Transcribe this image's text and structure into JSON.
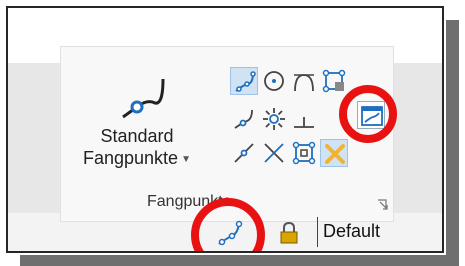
{
  "ribbon": {
    "big_button_line1": "Standard",
    "big_button_line2": "Fangpunkte",
    "group_label": "Fangpunkte"
  },
  "statusbar": {
    "level_name": "Default"
  },
  "icons": {
    "big": "snap-path-icon",
    "grid": [
      "keypoint-snap-icon",
      "center-snap-icon",
      "tangent-snap-icon",
      "origin-snap-icon",
      "nearest-snap-icon",
      "intersection-snap-icon",
      "perpendicular-snap-icon",
      "through-point-snap-icon",
      "midpoint-snap-icon",
      "bisector-snap-icon",
      "multi-snap-icon",
      "snap-off-icon"
    ],
    "status": [
      "active-snap-icon",
      "lock-icon"
    ]
  },
  "highlight_color": "#e81212",
  "accent_color": "#1e6fbf"
}
